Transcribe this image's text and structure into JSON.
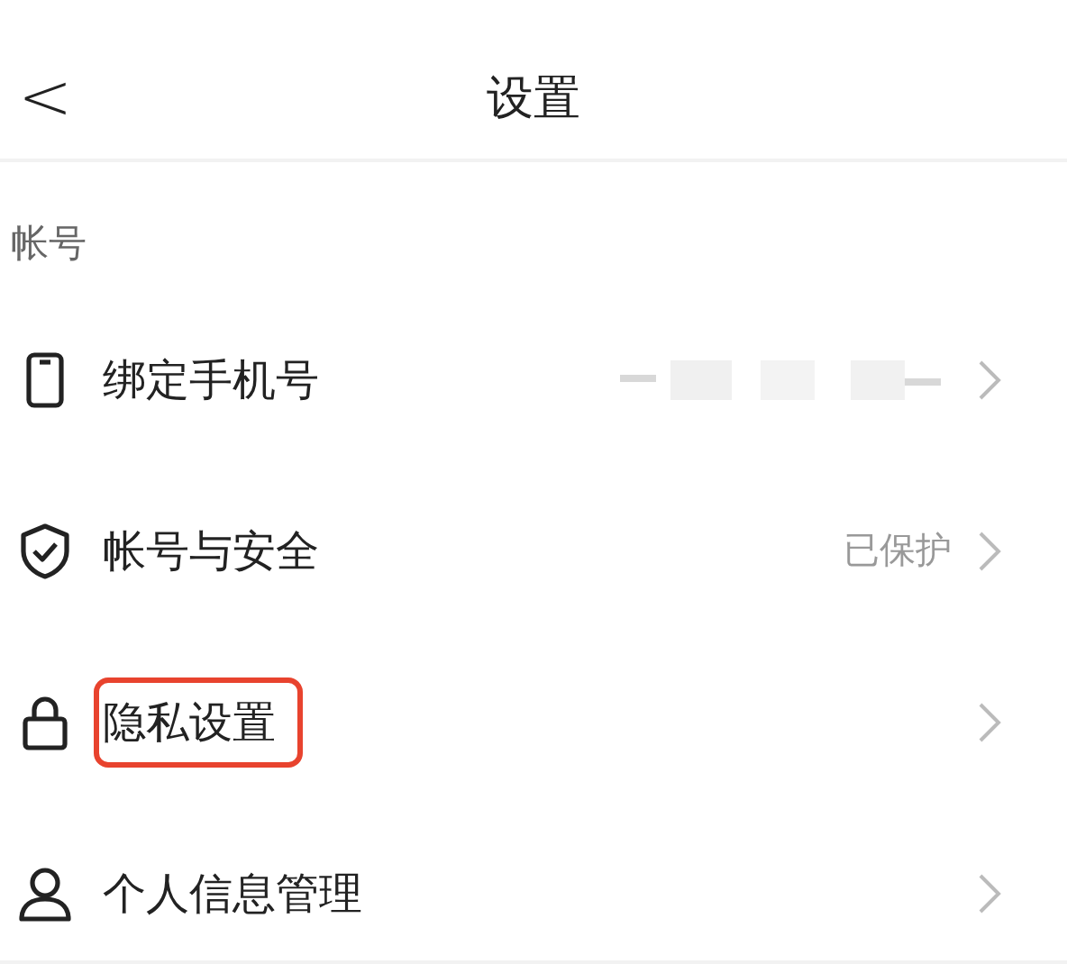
{
  "header": {
    "back": "<",
    "title": "设置"
  },
  "section": {
    "label": "帐号"
  },
  "rows": [
    {
      "kind": "phone",
      "label": "绑定手机号",
      "value_hidden": true,
      "highlighted": false
    },
    {
      "kind": "shield",
      "label": "帐号与安全",
      "value": "已保护",
      "highlighted": false
    },
    {
      "kind": "lock",
      "label": "隐私设置",
      "highlighted": true
    },
    {
      "kind": "person",
      "label": "个人信息管理",
      "highlighted": false
    }
  ]
}
